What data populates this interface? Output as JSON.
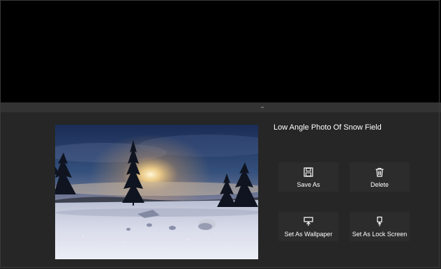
{
  "photo": {
    "title": "Low Angle Photo Of Snow Field"
  },
  "actions": [
    {
      "label": "Save As",
      "icon": "save-icon"
    },
    {
      "label": "Delete",
      "icon": "trash-icon"
    },
    {
      "label": "Set As Wallpaper",
      "icon": "wallpaper-icon"
    },
    {
      "label": "Set As Lock Screen",
      "icon": "lock-screen-icon"
    }
  ],
  "colors": {
    "background": "#000000",
    "panel": "#262626",
    "button": "#2c2c2c",
    "text": "#ffffff"
  }
}
